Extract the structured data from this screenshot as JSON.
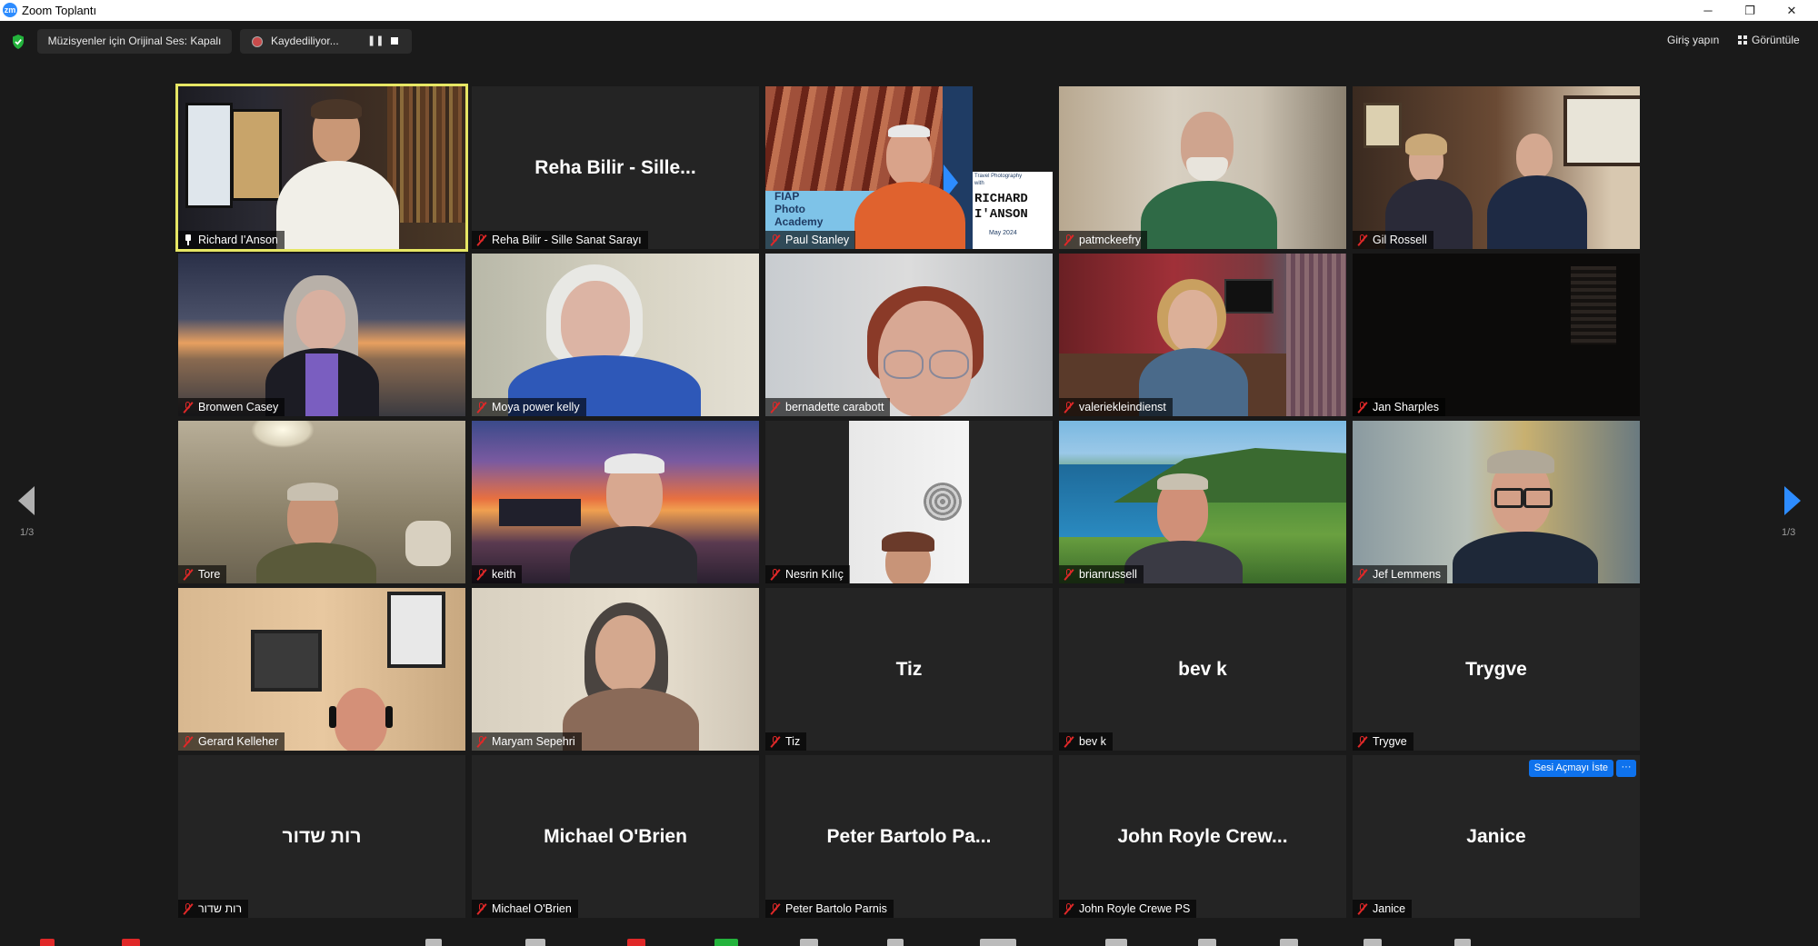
{
  "window": {
    "app_icon_text": "zm",
    "title": "Zoom Toplantı",
    "controls": {
      "minimize": "─",
      "restore": "❐",
      "close": "✕"
    }
  },
  "top_bar": {
    "original_audio": "Müzisyenler için Orijinal Ses: Kapalı",
    "recording_status": "Kaydediliyor...",
    "recording_pause": "❚❚",
    "sign_in": "Giriş yapın",
    "view": "Görüntüle"
  },
  "gallery": {
    "page_indicator_left": "1/3",
    "page_indicator_right": "1/3",
    "participants": [
      {
        "name": "Richard I'Anson",
        "big_name": "",
        "pinned": true,
        "speaking": true
      },
      {
        "name": "Reha Bilir - Sille Sanat Sarayı",
        "big_name": "Reha Bilir - Sille..."
      },
      {
        "name": "Paul Stanley",
        "big_name": ""
      },
      {
        "name": "patmckeefry",
        "big_name": ""
      },
      {
        "name": "Gil Rossell",
        "big_name": ""
      },
      {
        "name": "Bronwen Casey",
        "big_name": ""
      },
      {
        "name": "Moya power kelly",
        "big_name": ""
      },
      {
        "name": "bernadette carabott",
        "big_name": ""
      },
      {
        "name": "valeriekleindienst",
        "big_name": ""
      },
      {
        "name": "Jan Sharples",
        "big_name": ""
      },
      {
        "name": "Tore",
        "big_name": ""
      },
      {
        "name": "keith",
        "big_name": ""
      },
      {
        "name": "Nesrin Kılıç",
        "big_name": ""
      },
      {
        "name": "brianrussell",
        "big_name": ""
      },
      {
        "name": "Jef Lemmens",
        "big_name": ""
      },
      {
        "name": "Gerard Kelleher",
        "big_name": ""
      },
      {
        "name": "Maryam Sepehri",
        "big_name": ""
      },
      {
        "name": "Tiz",
        "big_name": "Tiz"
      },
      {
        "name": "bev k",
        "big_name": "bev k"
      },
      {
        "name": "Trygve",
        "big_name": "Trygve"
      },
      {
        "name": "רות שדור",
        "big_name": "רות שדור"
      },
      {
        "name": "Michael O'Brien",
        "big_name": "Michael O'Brien"
      },
      {
        "name": "Peter Bartolo Parnis",
        "big_name": "Peter Bartolo Pa..."
      },
      {
        "name": "John Royle Crewe PS",
        "big_name": "John Royle Crew..."
      },
      {
        "name": "Janice",
        "big_name": "Janice"
      }
    ],
    "paul_stanley_slide": {
      "left_text": [
        "FIAP",
        "Photo",
        "Academy"
      ],
      "right_small": [
        "Travel Photography",
        "with"
      ],
      "right_big": [
        "RICHARD",
        "I'ANSON"
      ],
      "right_date": "May 2024"
    },
    "janice_actions": {
      "ask_unmute": "Sesi Açmayı İste",
      "more": "···"
    }
  },
  "colors": {
    "accent": "#2d8cff",
    "speaking_border": "#e6e664",
    "muted_icon": "#e02828",
    "tile_bg": "#242424",
    "app_bg": "#1a1a1a"
  }
}
